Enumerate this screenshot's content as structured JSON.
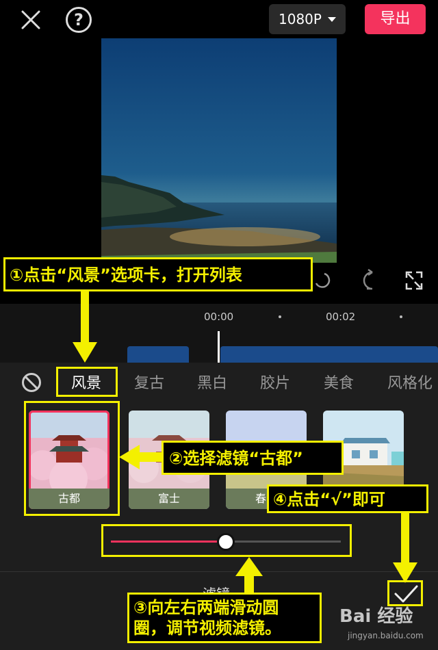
{
  "topbar": {
    "resolution": "1080P",
    "export_label": "导出"
  },
  "timeline": {
    "time_start": "00:00",
    "time_mid": "00:02"
  },
  "panel": {
    "tabs": [
      "风景",
      "复古",
      "黑白",
      "胶片",
      "美食",
      "风格化"
    ],
    "active_tab": "风景",
    "filters": [
      {
        "label": "古都",
        "selected": true
      },
      {
        "label": "富士",
        "selected": false
      },
      {
        "label": "春日",
        "selected": false
      },
      {
        "label": "",
        "selected": false
      }
    ],
    "intensity": 0.5,
    "title": "滤镜"
  },
  "annotations": {
    "step1": "①点击“风景”选项卡，打开列表",
    "step2": "②选择滤镜“古都”",
    "step3_line1": "③向左右两端滑动圆",
    "step3_line2": "圈，调节视频滤镜。",
    "step4": "④点击“√”即可"
  },
  "watermark": {
    "logo": "Bai 经验",
    "url": "jingyan.baidu.com"
  },
  "colors": {
    "accent": "#f4335d",
    "annotation": "#f4f000"
  }
}
